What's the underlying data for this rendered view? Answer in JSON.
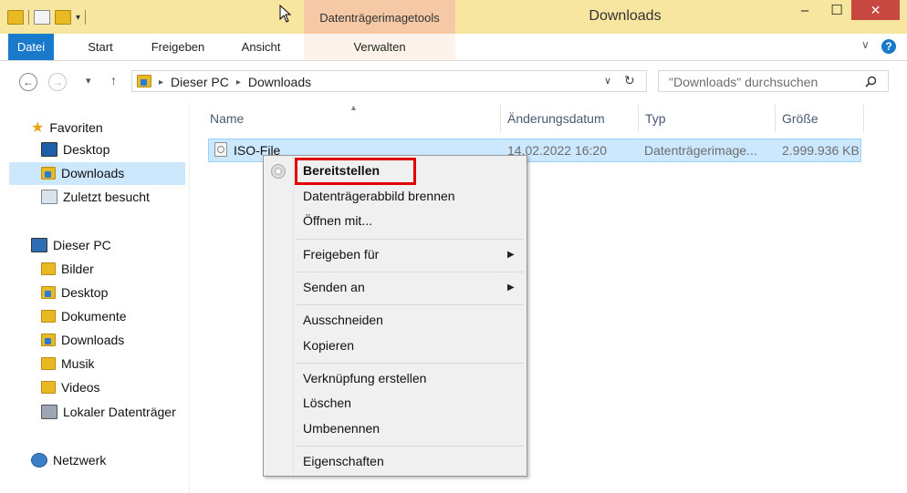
{
  "window": {
    "title": "Downloads",
    "context_tab": "Datenträgerimagetools",
    "minimize_glyph": "–",
    "maximize_glyph": "☐",
    "close_glyph": "✕"
  },
  "ribbon": {
    "tabs": [
      "Datei",
      "Start",
      "Freigeben",
      "Ansicht",
      "Verwalten"
    ],
    "help_glyph": "?",
    "collapse_glyph": "∨"
  },
  "address": {
    "path": [
      "Dieser PC",
      "Downloads"
    ],
    "search_placeholder": "\"Downloads\" durchsuchen"
  },
  "nav_pane": {
    "favorites_label": "Favoriten",
    "favorites": [
      "Desktop",
      "Downloads",
      "Zuletzt besucht"
    ],
    "pc_label": "Dieser PC",
    "pc_items": [
      "Bilder",
      "Desktop",
      "Dokumente",
      "Downloads",
      "Musik",
      "Videos",
      "Lokaler Datenträger"
    ],
    "network_label": "Netzwerk"
  },
  "columns": {
    "name": "Name",
    "date": "Änderungsdatum",
    "type": "Typ",
    "size": "Größe"
  },
  "files": [
    {
      "name": "ISO-File",
      "date": "14.02.2022 16:20",
      "type": "Datenträgerimage...",
      "size": "2.999.936 KB"
    }
  ],
  "context_menu": {
    "items": {
      "mount": "Bereitstellen",
      "burn": "Datenträgerabbild brennen",
      "open_with": "Öffnen mit...",
      "share_with": "Freigeben für",
      "send_to": "Senden an",
      "cut": "Ausschneiden",
      "copy": "Kopieren",
      "create_shortcut": "Verknüpfung erstellen",
      "delete": "Löschen",
      "rename": "Umbenennen",
      "properties": "Eigenschaften"
    },
    "highlight_color": "#e00000"
  },
  "colors": {
    "titlebar": "#f7e6a0",
    "context_tab": "#f5c9a6",
    "file_tab": "#1979ca",
    "selection": "#cce8ff",
    "close_button": "#c7483f"
  }
}
